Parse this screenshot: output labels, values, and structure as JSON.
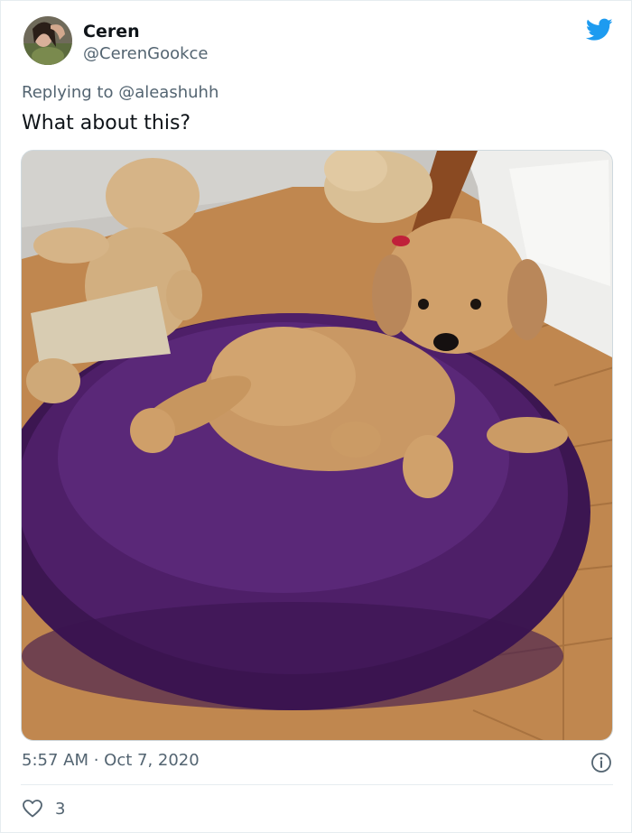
{
  "tweet": {
    "author": {
      "name": "Ceren",
      "handle": "@CerenGookce"
    },
    "reply_prefix": "Replying to ",
    "reply_to": "@aleashuhh",
    "text": "What about this?",
    "timestamp": "5:57 AM · Oct 7, 2020",
    "likes": "3"
  },
  "icons": {
    "brand": "twitter-bird-icon",
    "info": "info-icon",
    "like": "heart-icon"
  },
  "colors": {
    "brand": "#1d9bf0",
    "secondary_text": "#536471",
    "primary_text": "#0f1419",
    "border": "#cfd9de",
    "divider": "#e6ecf0"
  }
}
